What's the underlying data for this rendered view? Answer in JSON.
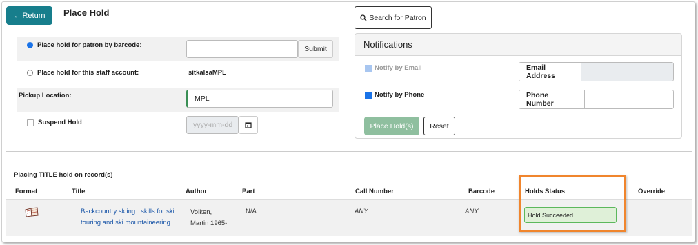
{
  "header": {
    "return_label": "Return",
    "page_title": "Place Hold",
    "search_patron_label": "Search for Patron"
  },
  "form": {
    "barcode_option_label": "Place hold for patron by barcode:",
    "barcode_value": "",
    "submit_label": "Submit",
    "staff_option_label": "Place hold for this staff account:",
    "staff_account": "sitkalsaMPL",
    "pickup_label": "Pickup Location:",
    "pickup_value": "MPL",
    "suspend_label": "Suspend Hold",
    "date_placeholder": "yyyy-mm-dd"
  },
  "notifications": {
    "title": "Notifications",
    "email_label": "Notify by Email",
    "email_field_label": "Email Address",
    "phone_label": "Notify by Phone",
    "phone_field_label": "Phone Number",
    "place_hold_label": "Place Hold(s)",
    "reset_label": "Reset"
  },
  "records": {
    "heading": "Placing TITLE hold on record(s)",
    "columns": [
      "Format",
      "Title",
      "Author",
      "Part",
      "Call Number",
      "Barcode",
      "Holds Status",
      "Override"
    ],
    "rows": [
      {
        "format_icon": "book-icon",
        "title_line1": "Backcountry skiing : skills for ski",
        "title_line2": "touring and ski mountaineering",
        "author_line1": "Volken,",
        "author_line2": "Martin 1965-",
        "part": "N/A",
        "call_number": "ANY",
        "barcode": "ANY",
        "holds_status": "Hold Succeeded"
      }
    ]
  },
  "colors": {
    "return_button": "#177e8c",
    "place_hold_button": "#8fbf9f",
    "radio_checked": "#1a73e8",
    "phone_checkbox": "#1a73e8",
    "status_success_bg": "#dff0d8",
    "highlight": "#f0852d"
  }
}
